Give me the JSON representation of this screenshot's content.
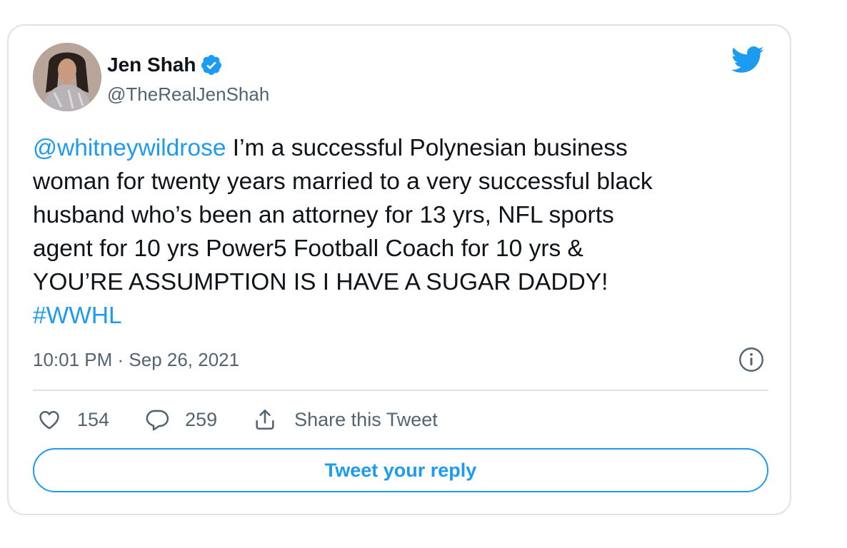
{
  "tweet": {
    "author": {
      "display_name": "Jen Shah",
      "handle": "@TheRealJenShah",
      "verified": true,
      "avatar_icon": "profile-photo"
    },
    "text": {
      "mention": "@whitneywildrose",
      "body": " I’m a successful Polynesian business\nwoman for twenty years married to a very successful black\nhusband who’s been an attorney for 13 yrs, NFL sports\nagent for 10 yrs Power5 Football Coach for 10 yrs &\nYOU’RE ASSUMPTION IS I HAVE A SUGAR DADDY!\n",
      "hashtag": "#WWHL"
    },
    "timestamp": "10:01 PM · Sep 26, 2021",
    "stats": {
      "likes": "154",
      "replies": "259",
      "share_label": "Share this Tweet"
    },
    "reply_button_label": "Tweet your reply"
  },
  "icons": {
    "brand": "twitter-bird-icon",
    "verified": "verified-badge-icon",
    "info": "info-icon",
    "like": "heart-icon",
    "reply": "speech-bubble-icon",
    "share": "share-upload-icon"
  },
  "colors": {
    "accent": "#1d9bf0",
    "text_primary": "#0f1419",
    "text_secondary": "#536471",
    "border": "#dde3e8"
  }
}
